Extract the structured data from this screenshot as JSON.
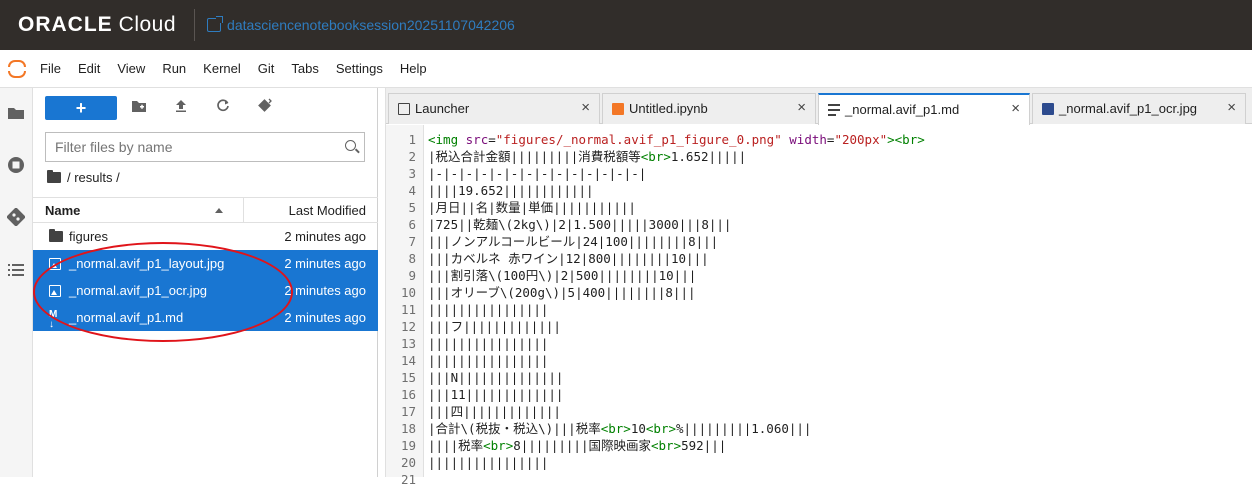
{
  "header": {
    "brand_bold": "ORACLE",
    "brand_light": "Cloud",
    "session_name": "datasciencenotebooksession20251107042206"
  },
  "menu": [
    "File",
    "Edit",
    "View",
    "Run",
    "Kernel",
    "Git",
    "Tabs",
    "Settings",
    "Help"
  ],
  "filebrowser": {
    "new_label": "+",
    "filter_placeholder": "Filter files by name",
    "breadcrumb": "/ results /",
    "col_name": "Name",
    "col_modified": "Last Modified",
    "rows": [
      {
        "name": "figures",
        "modified": "2 minutes ago",
        "type": "folder",
        "selected": false
      },
      {
        "name": "_normal.avif_p1_layout.jpg",
        "modified": "2 minutes ago",
        "type": "image",
        "selected": true
      },
      {
        "name": "_normal.avif_p1_ocr.jpg",
        "modified": "2 minutes ago",
        "type": "image",
        "selected": true
      },
      {
        "name": "_normal.avif_p1.md",
        "modified": "2 minutes ago",
        "type": "markdown",
        "selected": true
      }
    ]
  },
  "tabs": [
    {
      "label": "Launcher",
      "icon": "launcher-icon",
      "active": false
    },
    {
      "label": "Untitled.ipynb",
      "icon": "notebook-icon",
      "active": false
    },
    {
      "label": "_normal.avif_p1.md",
      "icon": "markdown-file-icon",
      "active": true
    },
    {
      "label": "_normal.avif_p1_ocr.jpg",
      "icon": "image-file-icon",
      "active": false
    }
  ],
  "close_glyph": "×",
  "editor": {
    "line_numbers": [
      "1",
      "2",
      "3",
      "4",
      "5",
      "6",
      "7",
      "8",
      "9",
      "10",
      "11",
      "12",
      "13",
      "14",
      "15",
      "16",
      "17",
      "18",
      "19",
      "20",
      "21"
    ],
    "lines": [
      "<img src=\"figures/_normal.avif_p1_figure_0.png\" width=\"200px\"><br>",
      "|税込合計金額|||||||||消費税額等<br>1.652|||||",
      "|-|-|-|-|-|-|-|-|-|-|-|-|-|-|",
      "||||19.652||||||||||||",
      "|月日||名|数量|単価|||||||||||",
      "|725||乾麺\\(2kg\\)|2|1.500|||||3000|||8|||",
      "|||ノンアルコールビール|24|100||||||||8|||",
      "|||カベルネ 赤ワイン|12|800||||||||10|||",
      "|||割引落\\(100円\\)|2|500||||||||10|||",
      "|||オリーブ\\(200g\\)|5|400||||||||8|||",
      "||||||||||||||||",
      "|||フ|||||||||||||",
      "||||||||||||||||",
      "||||||||||||||||",
      "|||N||||||||||||||",
      "|||11|||||||||||||",
      "|||四|||||||||||||",
      "|合計\\(税抜・税込\\)|||税率<br>10<br>%|||||||||1.060|||",
      "||||税率<br>8|||||||||国際映画家<br>592|||",
      "||||||||||||||||",
      ""
    ]
  }
}
